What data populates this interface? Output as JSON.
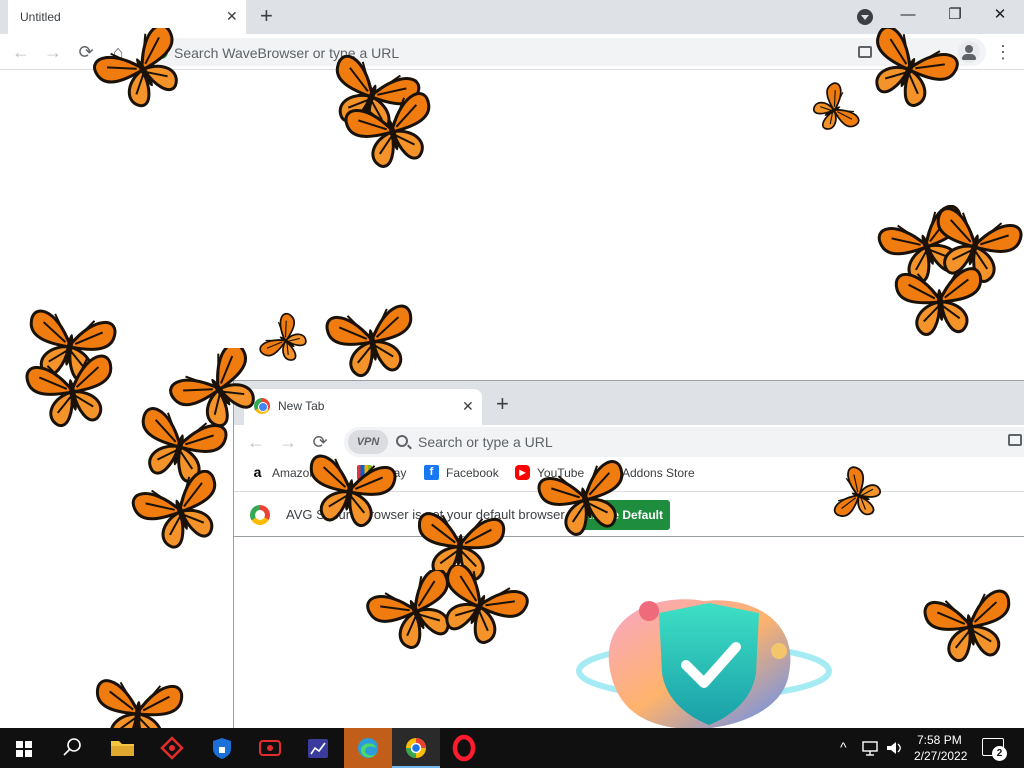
{
  "main_window": {
    "tab": {
      "title": "Untitled",
      "close": "✕"
    },
    "new_tab": "+",
    "window_controls": {
      "minimize": "—",
      "restore": "❐",
      "close": "✕"
    },
    "omnibox": {
      "placeholder": "Search WaveBrowser or type a URL"
    },
    "nav": {
      "back": "←",
      "forward": "→",
      "reload": "⟳",
      "home": "⌂"
    },
    "menu": "⋮"
  },
  "popup_window": {
    "tab": {
      "title": "New Tab",
      "close": "✕"
    },
    "new_tab": "+",
    "nav": {
      "back": "←",
      "forward": "→",
      "reload": "⟳"
    },
    "vpn_label": "VPN",
    "omnibox": {
      "placeholder": "Search or type a URL"
    },
    "bookmarks": [
      {
        "label": "Amazon.com",
        "icon": "amazon-icon",
        "icon_text": "a",
        "color": "#ffffff",
        "text_color": "#000000"
      },
      {
        "label": "eBay",
        "icon": "ebay-icon",
        "icon_text": "e",
        "color": "#e53238",
        "text_color": "#ffffff"
      },
      {
        "label": "Facebook",
        "icon": "facebook-icon",
        "icon_text": "f",
        "color": "#1877f2",
        "text_color": "#ffffff"
      },
      {
        "label": "YouTube",
        "icon": "youtube-icon",
        "icon_text": "▶",
        "color": "#ff0000",
        "text_color": "#ffffff"
      },
      {
        "label": "Addons Store",
        "icon": "addons-store-icon",
        "icon_text": "✱",
        "color": "#1e8e3e",
        "text_color": "#ffffff"
      }
    ],
    "infobar": {
      "message": "AVG Secure Browser is not your default browser",
      "button": "Make Default"
    }
  },
  "taskbar": {
    "clock": {
      "time": "7:58 PM",
      "date": "2/27/2022"
    },
    "notification_count": "2",
    "tray_chevron": "^",
    "apps": [
      {
        "name": "start-button"
      },
      {
        "name": "search-button"
      },
      {
        "name": "file-explorer"
      },
      {
        "name": "avg-antivirus"
      },
      {
        "name": "vpn-app"
      },
      {
        "name": "screen-recorder"
      },
      {
        "name": "task-manager-app"
      },
      {
        "name": "edge-browser"
      },
      {
        "name": "avg-secure-browser"
      },
      {
        "name": "opera-browser"
      }
    ]
  },
  "colors": {
    "butterfly_orange": "#f07c10",
    "butterfly_black": "#1a1208",
    "infobar_button": "#1e8e3e",
    "taskbar": "#101010"
  }
}
